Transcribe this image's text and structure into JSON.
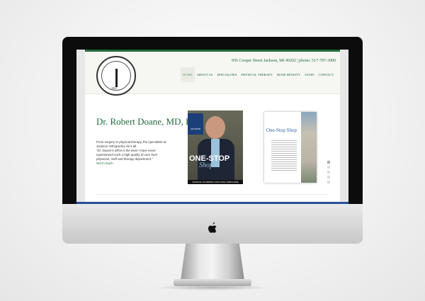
{
  "site": {
    "address_line": "956 Cooper Street Jackson, MI 49202 | phone: 517-787-3900",
    "logo_year": "2002",
    "nav": [
      {
        "label": "HOME",
        "active": true
      },
      {
        "label": "ABOUT US"
      },
      {
        "label": "SPECIALTIES"
      },
      {
        "label": "PHYSICAL THERAPY"
      },
      {
        "label": "BONE DENSITY"
      },
      {
        "label": "STAFF"
      },
      {
        "label": "CONTACT"
      }
    ],
    "hero": {
      "title": "Dr. Robert Doane, MD, PC",
      "intro": "From surgery to physical therapy, the specialists at Jackson Orthopedics do it all.",
      "quote": "\"Dr. Doane's office is the best! I have never experienced such a high quality of care from physician, staff and therapy department.\"",
      "link": "Get in touch"
    },
    "magazine_cover": {
      "brand": "JACKSON",
      "headline": "ONE-STOP",
      "script": "Shop",
      "footer": "FINANCE: PLANNING FOR LONG-TERM CARE"
    },
    "magazine_spread": {
      "title": "One-Stop Shop"
    },
    "slider_dots": 5,
    "slider_active": 1
  },
  "colors": {
    "brand_green": "#1f6b3a",
    "accent_blue": "#27509a"
  },
  "icons": {
    "device_logo": "apple-logo-icon"
  }
}
